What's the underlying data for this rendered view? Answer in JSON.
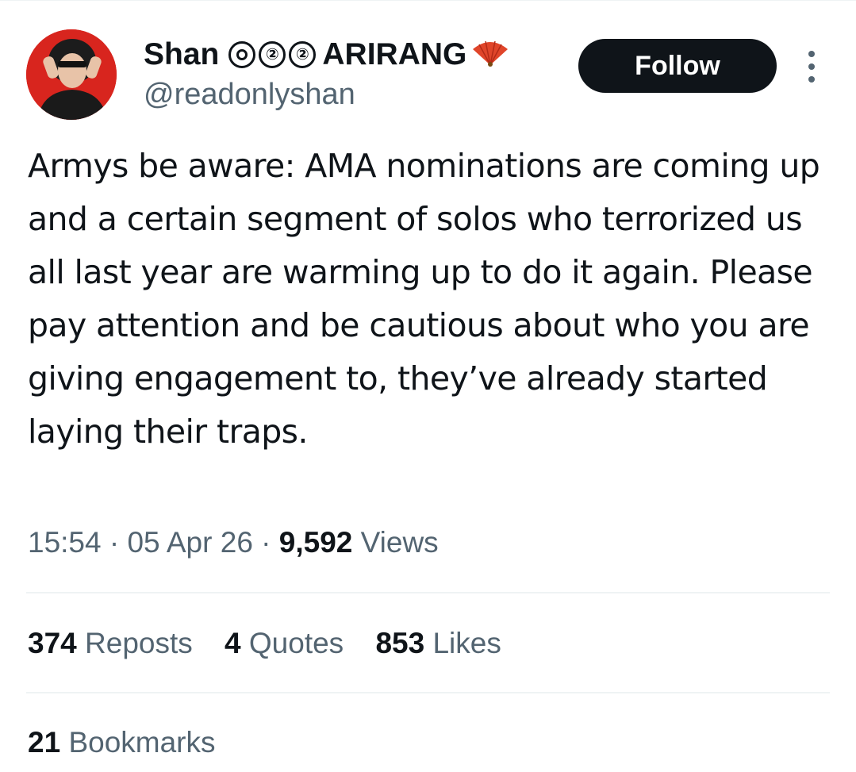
{
  "author": {
    "name": "Shan",
    "badges": [
      "⓪",
      "②",
      "②"
    ],
    "name_suffix": "ARIRANG",
    "handle": "@readonlyshan",
    "avatar_icon": "profile-avatar",
    "emoji_icon": "folding-fan-icon"
  },
  "follow_button": {
    "label": "Follow"
  },
  "more_icon": "more-options-icon",
  "tweet": {
    "text": "Armys be aware: AMA nominations are coming up and a certain segment of solos who terrorized us all last year are warming up to do it again. Please pay attention and be cautious about who you are giving engagement to, they’ve already started laying their traps."
  },
  "meta": {
    "time": "15:54",
    "date": "05 Apr 26",
    "views_count": "9,592",
    "views_label": "Views",
    "separator": "·"
  },
  "stats": {
    "reposts_count": "374",
    "reposts_label": "Reposts",
    "quotes_count": "4",
    "quotes_label": "Quotes",
    "likes_count": "853",
    "likes_label": "Likes",
    "bookmarks_count": "21",
    "bookmarks_label": "Bookmarks"
  },
  "colors": {
    "text": "#0f1419",
    "secondary": "#536471",
    "divider": "#eff3f4",
    "avatar_bg": "#d8251e",
    "fan": "#e0452a"
  }
}
